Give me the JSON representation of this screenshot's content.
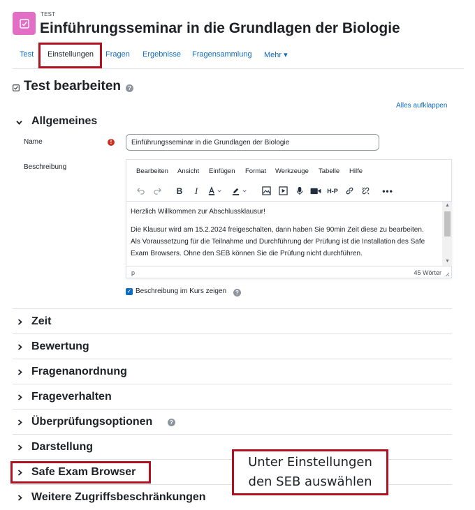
{
  "header": {
    "activity_type": "TEST",
    "title": "Einführungsseminar in die Grundlagen der Biologie",
    "icon_color": "#e26ec5"
  },
  "nav": {
    "tabs": [
      {
        "label": "Test"
      },
      {
        "label": "Einstellungen"
      },
      {
        "label": "Fragen"
      },
      {
        "label": "Ergebnisse"
      },
      {
        "label": "Fragensammlung"
      },
      {
        "label": "Mehr ▾"
      }
    ],
    "active_tab": "Einstellungen"
  },
  "page": {
    "section_title": "Test bearbeiten",
    "expand_all": "Alles aufklappen"
  },
  "general": {
    "title": "Allgemeines",
    "name_label": "Name",
    "name_value": "Einführungsseminar in die Grundlagen der Biologie",
    "description_label": "Beschreibung",
    "show_description_label": "Beschreibung im Kurs zeigen",
    "show_description_checked": true
  },
  "editor": {
    "menu": [
      "Bearbeiten",
      "Ansicht",
      "Einfügen",
      "Format",
      "Werkzeuge",
      "Tabelle",
      "Hilfe"
    ],
    "toolbar_icons": [
      "undo-icon",
      "redo-icon",
      "bold-icon",
      "italic-icon",
      "text-color-icon",
      "highlight-color-icon",
      "image-icon",
      "media-icon",
      "record-audio-icon",
      "record-video-icon",
      "h5p-icon",
      "link-icon",
      "unlink-icon",
      "more-icon"
    ],
    "content": {
      "p1": "Herzlich Willkommen zur Abschlussklausur!",
      "p2_line1": "Die Klausur wird am 15.2.2024 freigeschalten, dann haben Sie 90min Zeit diese zu bearbeiten.",
      "p2_line2": "Als Voraussetzung für die Teilnahme und Durchführung der Prüfung ist die Installation des Safe",
      "p2_line3": "Exam Browsers. Ohne den SEB können Sie die Prüfung nicht durchführen."
    },
    "status_path": "p",
    "word_count": "45 Wörter"
  },
  "sections": [
    {
      "title": "Zeit"
    },
    {
      "title": "Bewertung"
    },
    {
      "title": "Fragenanordnung"
    },
    {
      "title": "Frageverhalten"
    },
    {
      "title": "Überprüfungsoptionen"
    },
    {
      "title": "Darstellung"
    },
    {
      "title": "Safe Exam Browser"
    },
    {
      "title": "Weitere Zugriffsbeschränkungen"
    }
  ],
  "annotation": {
    "line1": "Unter Einstellungen",
    "line2": "den SEB auswählen",
    "color": "#b2121f"
  }
}
